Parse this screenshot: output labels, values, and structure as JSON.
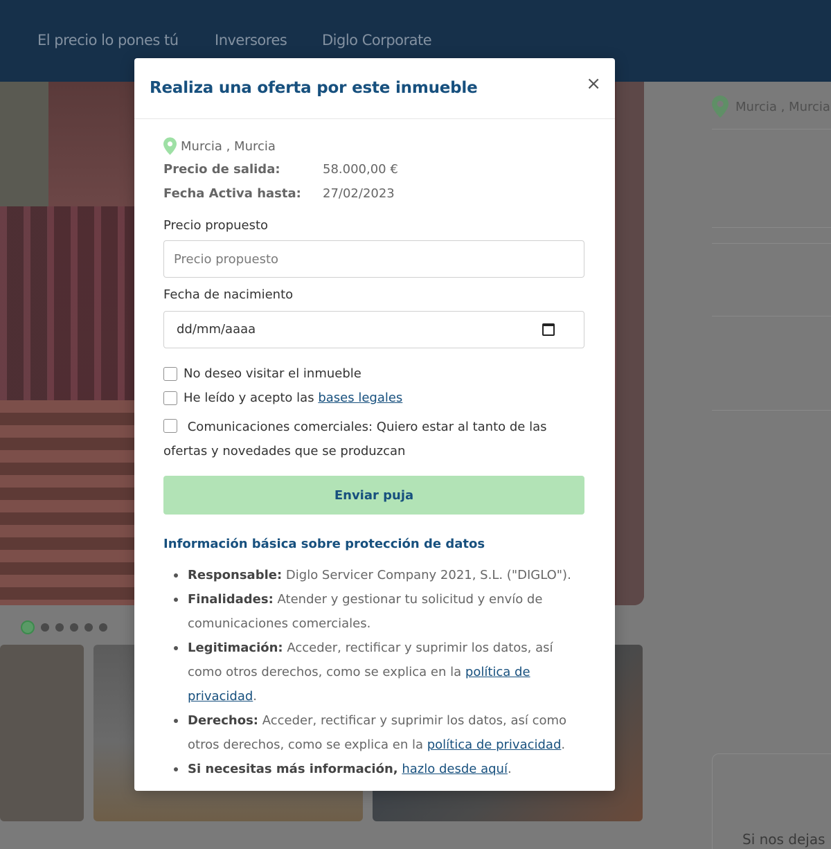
{
  "nav": {
    "items": [
      "El precio lo pones tú",
      "Inversores",
      "Diglo Corporate"
    ]
  },
  "background": {
    "location": "Murcia , Murcia",
    "footer_text": "Si nos dejas"
  },
  "modal": {
    "title": "Realiza una oferta por este inmueble",
    "close": "×",
    "location": "Murcia , Murcia",
    "precio_label": "Precio de salida:",
    "precio_value": "58.000,00 €",
    "fecha_label": "Fecha Activa hasta:",
    "fecha_value": "27/02/2023",
    "precio_propuesto_label": "Precio propuesto",
    "precio_propuesto_placeholder": "Precio propuesto",
    "precio_propuesto_value": "",
    "nacimiento_label": "Fecha de nacimiento",
    "nacimiento_placeholder": "dd/mm/aaaa",
    "checkbox_no_visit": "No deseo visitar el inmueble",
    "checkbox_legal_prefix": "He leído y acepto las",
    "checkbox_legal_link": "bases legales",
    "checkbox_comms": "Comunicaciones comerciales: Quiero estar al tanto de las ofertas y novedades que se produzcan",
    "submit": "Enviar puja",
    "privacy_title": "Información básica sobre protección de datos",
    "privacy": {
      "responsable_label": "Responsable:",
      "responsable_text": "Diglo Servicer Company 2021, S.L. (\"DIGLO\").",
      "finalidades_label": "Finalidades:",
      "finalidades_text": "Atender y gestionar tu solicitud y envío de comunicaciones comerciales.",
      "legitimacion_label": "Legitimación:",
      "legitimacion_text": "Acceder, rectificar y suprimir los datos, así como otros derechos, como se explica en la",
      "legitimacion_link": "política de privacidad",
      "derechos_label": "Derechos:",
      "derechos_text": "Acceder, rectificar y suprimir los datos, así como otros derechos, como se explica en la",
      "derechos_link": "política de privacidad",
      "mas_info_label": "Si necesitas más información,",
      "mas_info_link": "hazlo desde aquí"
    }
  },
  "colors": {
    "nav_bg": "#16304a",
    "title": "#17507e",
    "submit_bg": "#b2e3b6",
    "pin": "#9ee0a5"
  }
}
